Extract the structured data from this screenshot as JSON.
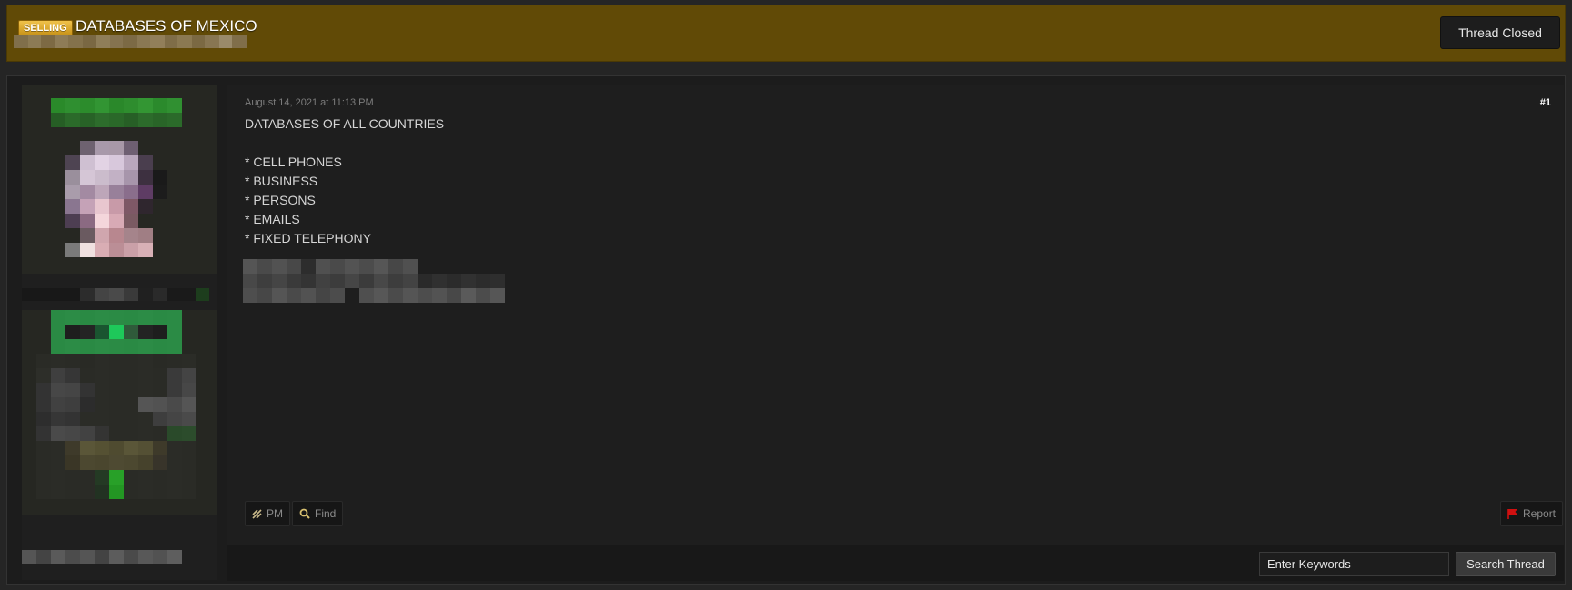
{
  "thread": {
    "prefix": "SELLING",
    "title": "DATABASES OF MEXICO",
    "status_button": "Thread Closed"
  },
  "post": {
    "date": "August 14, 2021 at 11:13 PM",
    "number": "#1",
    "lines": [
      "DATABASES OF ALL COUNTRIES",
      "",
      "* CELL PHONES",
      "* BUSINESS",
      "* PERSONS",
      "* EMAILS",
      "* FIXED TELEPHONY"
    ],
    "actions": {
      "pm": "PM",
      "find": "Find",
      "report": "Report"
    }
  },
  "search": {
    "placeholder": "Enter Keywords",
    "button": "Search Thread"
  },
  "colors": {
    "header_bg": "#614a06",
    "badge": "#e0a82a",
    "report_flag": "#d01010"
  }
}
